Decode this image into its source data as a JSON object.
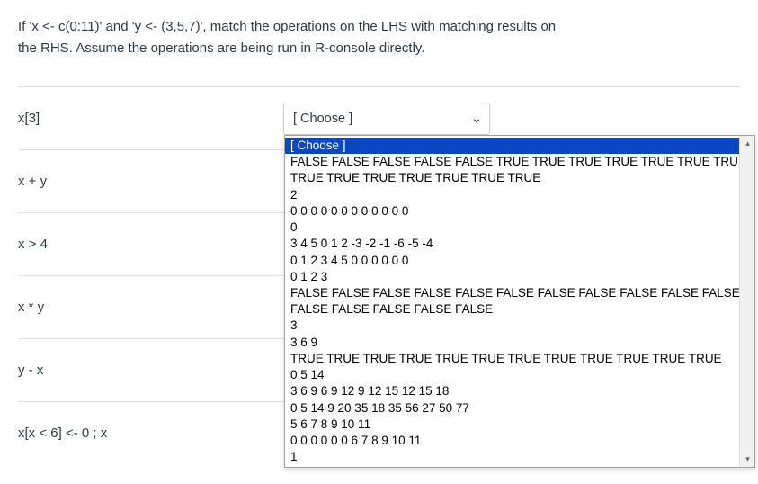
{
  "question": {
    "line1": "If 'x <- c(0:11)' and 'y <- (3,5,7)', match the operations on the LHS with matching results on",
    "line2": "the RHS. Assume the operations are being run in R-console directly."
  },
  "selectPlaceholder": "[ Choose ]",
  "rows": [
    {
      "lhs": "x[3]"
    },
    {
      "lhs": "x + y"
    },
    {
      "lhs": "x > 4"
    },
    {
      "lhs": "x * y"
    },
    {
      "lhs": "y - x"
    },
    {
      "lhs": "x[x < 6] <- 0 ; x"
    }
  ],
  "options": [
    "[ Choose ]",
    "FALSE FALSE FALSE FALSE FALSE TRUE TRUE TRUE TRUE TRUE TRUE TRUE",
    "TRUE TRUE TRUE TRUE TRUE TRUE TRUE",
    "2",
    "0 0 0 0 0 0 0 0 0 0 0 0",
    "0",
    "3 4 5 0 1 2 -3 -2 -1 -6 -5 -4",
    "0 1 2 3 4 5 0 0 0 0 0 0",
    "0 1 2 3",
    "FALSE FALSE FALSE FALSE FALSE FALSE FALSE FALSE FALSE FALSE FALSE FALSE",
    "FALSE FALSE FALSE FALSE FALSE",
    "3",
    "3 6 9",
    "TRUE TRUE TRUE TRUE TRUE TRUE TRUE TRUE TRUE TRUE TRUE TRUE",
    "0 5 14",
    "3 6 9 6 9 12 9 12 15 12 15 18",
    "0 5 14 9 20 35 18 35 56 27 50 77",
    "5 6 7 8 9 10 11",
    "0 0 0 0 0 0 6 7 8 9 10 11",
    "1"
  ],
  "scrollArrows": {
    "up": "▴",
    "down": "▾"
  },
  "selectCaret": "⌄"
}
